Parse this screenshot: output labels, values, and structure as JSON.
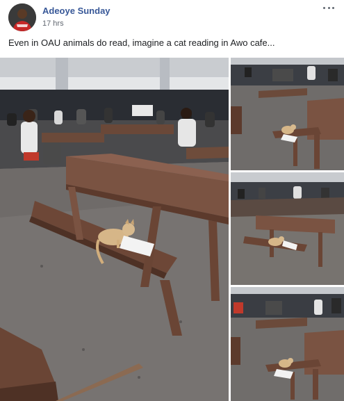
{
  "post": {
    "author": "Adeoye Sunday",
    "timestamp": "17 hrs",
    "text": "Even in OAU animals do read, imagine a cat reading in Awo cafe..."
  },
  "icons": {
    "more": "more-options-icon",
    "avatar": "profile-avatar"
  },
  "colors": {
    "author_link": "#385898",
    "meta_text": "#616770",
    "body_text": "#1c1e21"
  },
  "photos": [
    {
      "id": "main",
      "subject": "cat-on-bench-with-paper"
    },
    {
      "id": "top",
      "subject": "cat-on-bench-with-paper"
    },
    {
      "id": "mid",
      "subject": "cat-on-bench-with-paper"
    },
    {
      "id": "bot",
      "subject": "cat-on-bench-with-paper"
    }
  ]
}
